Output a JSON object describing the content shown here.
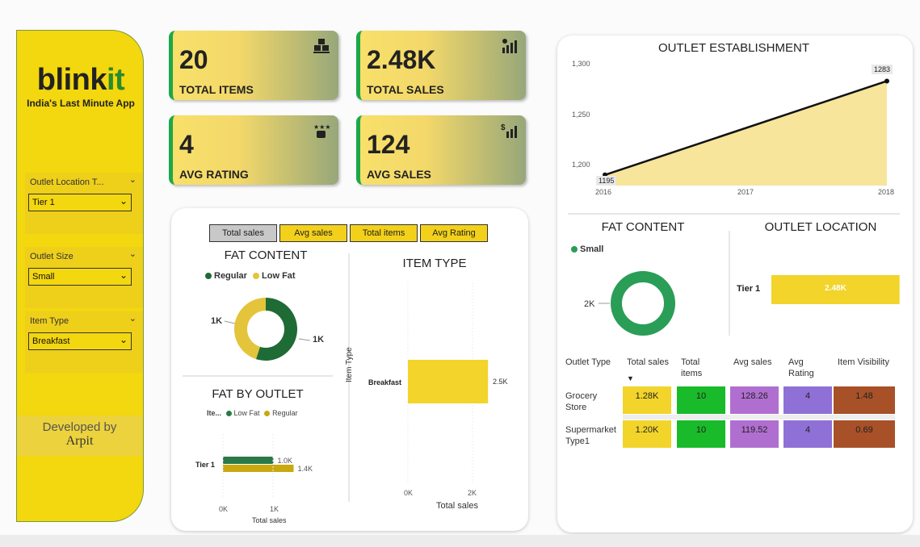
{
  "sidebar": {
    "logo_main": "blink",
    "logo_accent": "it",
    "tagline": "India's Last Minute App",
    "slicers": [
      {
        "label": "Outlet Location T...",
        "value": "Tier 1"
      },
      {
        "label": "Outlet Size",
        "value": "Small"
      },
      {
        "label": "Item Type",
        "value": "Breakfast"
      }
    ],
    "developer_label": "Developed by",
    "developer_name": "Arpit"
  },
  "kpis": [
    {
      "value": "20",
      "label": "TOTAL ITEMS",
      "icon": "boxes-icon"
    },
    {
      "value": "2.48K",
      "label": "TOTAL SALES",
      "icon": "sales-chart-icon"
    },
    {
      "value": "4",
      "label": "AVG RATING",
      "icon": "rating-stars-icon"
    },
    {
      "value": "124",
      "label": "AVG SALES",
      "icon": "dollar-chart-icon"
    }
  ],
  "colors": {
    "yellow": "#f3d72a",
    "dark_green": "#1f6b35",
    "green": "#2a9d57",
    "gold": "#c9b02a",
    "matrix_green": "#19bb2a",
    "matrix_purple": "#b06fd0",
    "matrix_violet": "#8f70d6",
    "matrix_brown": "#a85028"
  },
  "tabs": [
    "Total sales",
    "Avg sales",
    "Total items",
    "Avg Rating"
  ],
  "fat_content_left": {
    "title": "FAT CONTENT",
    "legend": [
      "Regular",
      "Low Fat"
    ],
    "slices": [
      {
        "name": "Regular",
        "label": "1K",
        "share": 0.56
      },
      {
        "name": "Low Fat",
        "label": "1K",
        "share": 0.44
      }
    ]
  },
  "fat_by_outlet": {
    "title": "FAT BY OUTLET",
    "legend_title": "Ite...",
    "legend": [
      "Low Fat",
      "Regular"
    ],
    "category": "Tier 1",
    "bars": [
      {
        "name": "Low Fat",
        "value": 1.0,
        "label": "1.0K"
      },
      {
        "name": "Regular",
        "value": 1.4,
        "label": "1.4K"
      }
    ],
    "ticks": [
      "0K",
      "1K"
    ],
    "xlabel": "Total sales"
  },
  "item_type": {
    "title": "ITEM TYPE",
    "category": "Breakfast",
    "value_label": "2.5K",
    "ylabel": "Item Type",
    "ticks": [
      "0K",
      "2K"
    ],
    "xlabel": "Total sales"
  },
  "establishment": {
    "title": "OUTLET ESTABLISHMENT",
    "y_ticks": [
      "1,300",
      "1,250",
      "1,200"
    ],
    "x_ticks": [
      "2016",
      "2017",
      "2018"
    ],
    "start_label": "1195",
    "end_label": "1283"
  },
  "fat_content_right": {
    "title": "FAT CONTENT",
    "legend": [
      "Small"
    ],
    "value_label": "2K"
  },
  "outlet_location": {
    "title": "OUTLET LOCATION",
    "category": "Tier 1",
    "value_label": "2.48K"
  },
  "matrix": {
    "headers": [
      "Outlet Type",
      "Total sales",
      "Total items",
      "Avg sales",
      "Avg Rating",
      "Item Visibility"
    ],
    "header_lines": [
      [
        "Outlet Type"
      ],
      [
        "Total sales"
      ],
      [
        "Total",
        "items"
      ],
      [
        "Avg sales"
      ],
      [
        "Avg",
        "Rating"
      ],
      [
        "Item Visibility"
      ]
    ],
    "rows": [
      {
        "type_l1": "Grocery",
        "type_l2": "Store",
        "total_sales": "1.28K",
        "total_items": "10",
        "avg_sales": "128.26",
        "avg_rating": "4",
        "visibility": "1.48"
      },
      {
        "type_l1": "Supermarket",
        "type_l2": "Type1",
        "total_sales": "1.20K",
        "total_items": "10",
        "avg_sales": "119.52",
        "avg_rating": "4",
        "visibility": "0.69"
      }
    ]
  },
  "chart_data": [
    {
      "type": "pie",
      "title": "FAT CONTENT",
      "categories": [
        "Regular",
        "Low Fat"
      ],
      "values": [
        1.1,
        0.9
      ],
      "labels": [
        "1K",
        "1K"
      ]
    },
    {
      "type": "bar",
      "title": "FAT BY OUTLET",
      "categories": [
        "Tier 1"
      ],
      "series": [
        {
          "name": "Low Fat",
          "values": [
            1.0
          ]
        },
        {
          "name": "Regular",
          "values": [
            1.4
          ]
        }
      ],
      "xlabel": "Total sales",
      "xlim": [
        0,
        1.9
      ]
    },
    {
      "type": "bar",
      "title": "ITEM TYPE",
      "categories": [
        "Breakfast"
      ],
      "values": [
        2.48
      ],
      "xlabel": "Total sales",
      "ylabel": "Item Type",
      "xlim": [
        0,
        2.9
      ]
    },
    {
      "type": "area",
      "title": "OUTLET ESTABLISHMENT",
      "x": [
        "2016",
        "2017",
        "2018"
      ],
      "values": [
        1195,
        1239,
        1283
      ],
      "ylim": [
        1185,
        1300
      ]
    },
    {
      "type": "pie",
      "title": "FAT CONTENT",
      "categories": [
        "Small"
      ],
      "values": [
        2.48
      ],
      "labels": [
        "2K"
      ]
    },
    {
      "type": "bar",
      "title": "OUTLET LOCATION",
      "categories": [
        "Tier 1"
      ],
      "values": [
        2.48
      ],
      "labels": [
        "2.48K"
      ],
      "xlim": [
        0,
        3.45
      ]
    }
  ]
}
